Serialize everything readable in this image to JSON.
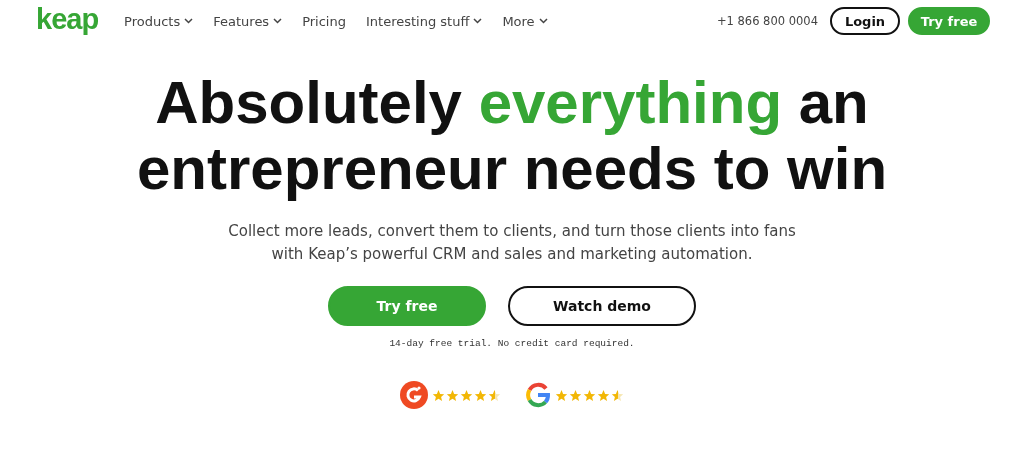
{
  "nav": {
    "logo": "keap",
    "items": [
      {
        "label": "Products",
        "dropdown": true
      },
      {
        "label": "Features",
        "dropdown": true
      },
      {
        "label": "Pricing",
        "dropdown": false
      },
      {
        "label": "Interesting stuff",
        "dropdown": true
      },
      {
        "label": "More",
        "dropdown": true
      }
    ],
    "phone": "+1 866 800 0004",
    "login": "Login",
    "try_free": "Try free"
  },
  "hero": {
    "headline_line_1": [
      {
        "text": "Absolutely ",
        "highlight": false
      },
      {
        "text": "everything",
        "highlight": true
      },
      {
        "text": " an",
        "highlight": false
      }
    ],
    "headline_line_2": [
      {
        "text": "entrepreneur needs to win",
        "highlight": false
      }
    ],
    "subtitle": "Collect more leads, convert them to clients, and turn those clients into fans with Keap’s powerful CRM and sales and marketing automation.",
    "primary_button": "Try free",
    "secondary_button": "Watch demo",
    "note": "14-day free trial. No credit card required.",
    "ratings": [
      {
        "kind": "g2",
        "stars": 4.5
      },
      {
        "kind": "google",
        "stars": 4.5
      }
    ]
  }
}
